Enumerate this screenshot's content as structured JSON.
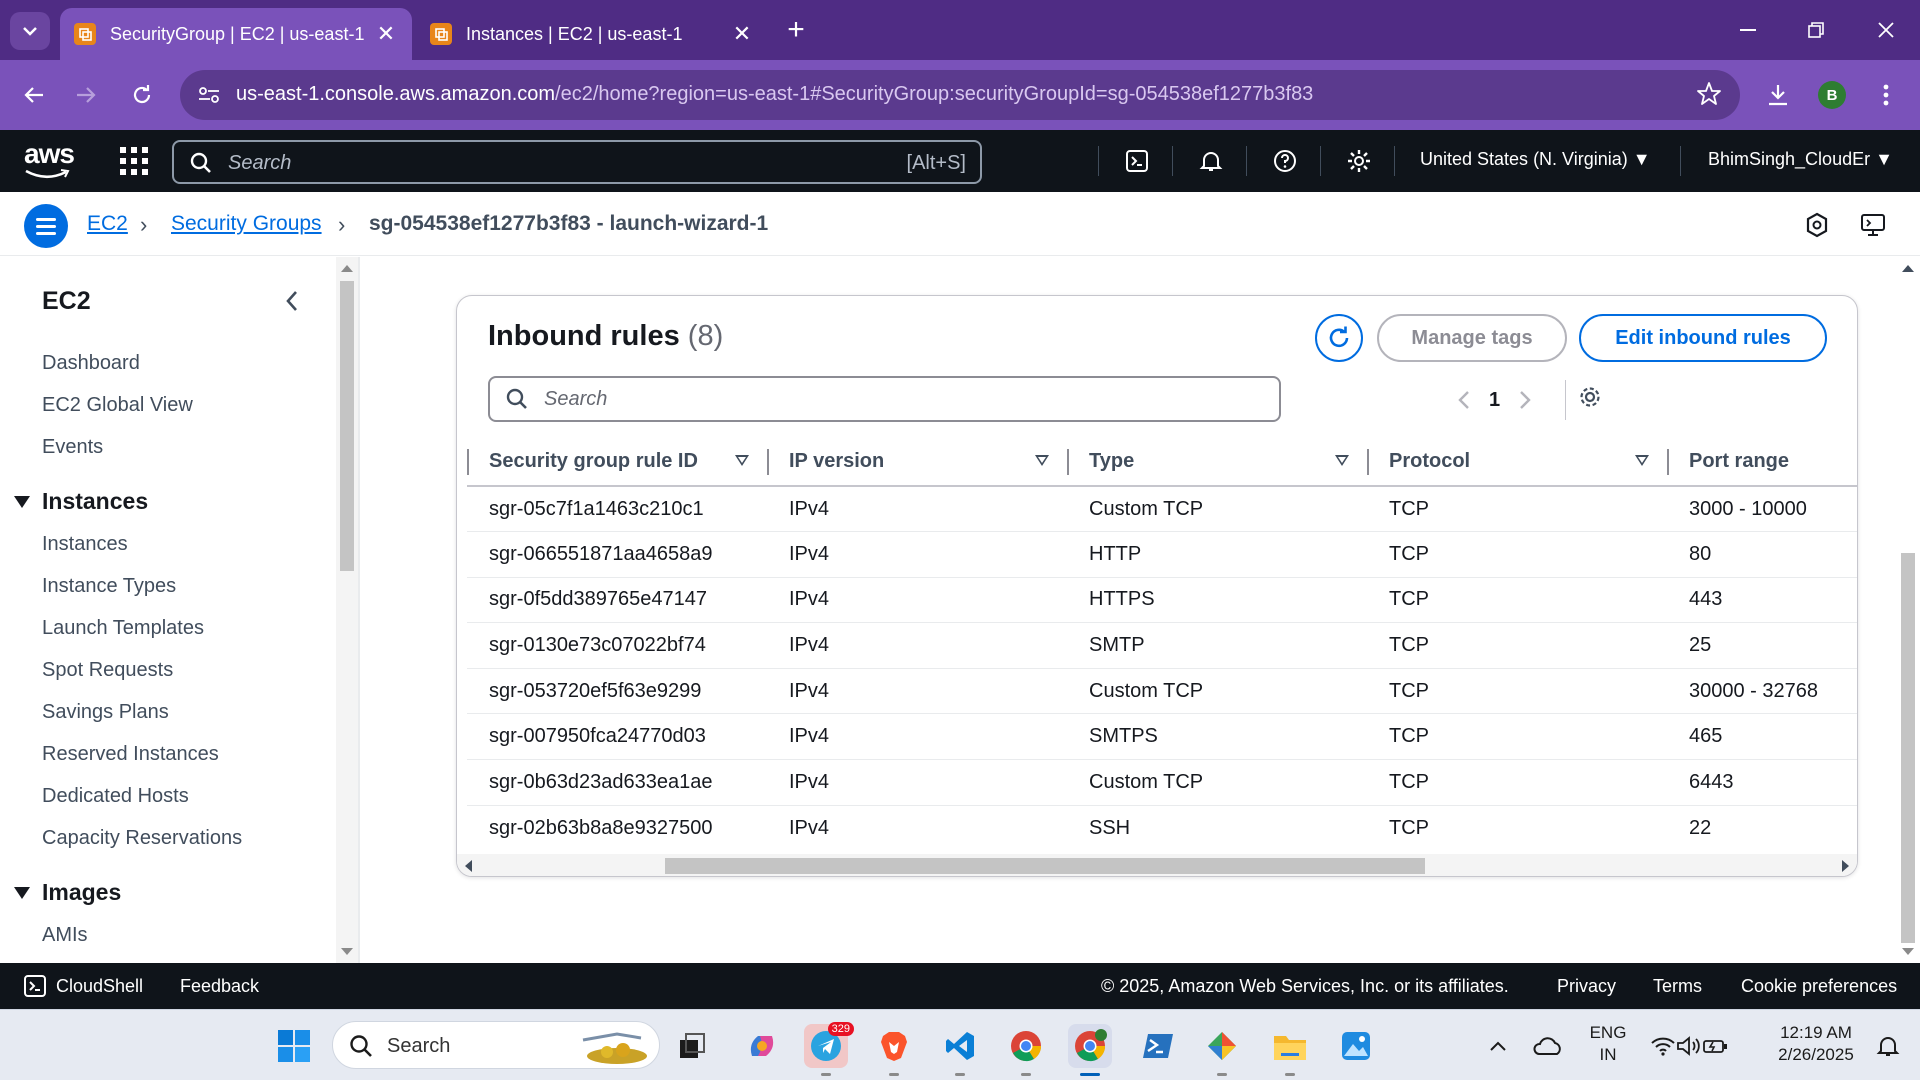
{
  "browser": {
    "tabs": [
      {
        "title": "SecurityGroup | EC2 | us-east-1",
        "active": true
      },
      {
        "title": "Instances | EC2 | us-east-1",
        "active": false
      }
    ],
    "url_host": "us-east-1.console.aws.amazon.com",
    "url_path": "/ec2/home?region=us-east-1#SecurityGroup:securityGroupId=sg-054538ef1277b3f83",
    "profile_initial": "B",
    "accent": "#7a52ba"
  },
  "aws_nav": {
    "logo": "aws",
    "search_placeholder": "Search",
    "search_shortcut": "[Alt+S]",
    "region": "United States (N. Virginia)",
    "account": "BhimSingh_CloudEr"
  },
  "breadcrumb": {
    "items": [
      "EC2",
      "Security Groups"
    ],
    "current": "sg-054538ef1277b3f83 - launch-wizard-1"
  },
  "sidebar": {
    "title": "EC2",
    "top_items": [
      "Dashboard",
      "EC2 Global View",
      "Events"
    ],
    "sections": [
      {
        "label": "Instances",
        "items": [
          "Instances",
          "Instance Types",
          "Launch Templates",
          "Spot Requests",
          "Savings Plans",
          "Reserved Instances",
          "Dedicated Hosts",
          "Capacity Reservations"
        ]
      },
      {
        "label": "Images",
        "items": [
          "AMIs"
        ]
      }
    ]
  },
  "inbound": {
    "title": "Inbound rules",
    "count": "(8)",
    "manage_tags": "Manage tags",
    "edit_rules": "Edit inbound rules",
    "search_placeholder": "Search",
    "page": "1",
    "columns": [
      "Security group rule ID",
      "IP version",
      "Type",
      "Protocol",
      "Port range"
    ],
    "rows": [
      [
        "sgr-05c7f1a1463c210c1",
        "IPv4",
        "Custom TCP",
        "TCP",
        "3000 - 10000"
      ],
      [
        "sgr-066551871aa4658a9",
        "IPv4",
        "HTTP",
        "TCP",
        "80"
      ],
      [
        "sgr-0f5dd389765e47147",
        "IPv4",
        "HTTPS",
        "TCP",
        "443"
      ],
      [
        "sgr-0130e73c07022bf74",
        "IPv4",
        "SMTP",
        "TCP",
        "25"
      ],
      [
        "sgr-053720ef5f63e9299",
        "IPv4",
        "Custom TCP",
        "TCP",
        "30000 - 32768"
      ],
      [
        "sgr-007950fca24770d03",
        "IPv4",
        "SMTPS",
        "TCP",
        "465"
      ],
      [
        "sgr-0b63d23ad633ea1ae",
        "IPv4",
        "Custom TCP",
        "TCP",
        "6443"
      ],
      [
        "sgr-02b63b8a8e9327500",
        "IPv4",
        "SSH",
        "TCP",
        "22"
      ]
    ],
    "link_color": "#006ce0"
  },
  "footer": {
    "cloudshell": "CloudShell",
    "feedback": "Feedback",
    "copyright": "© 2025, Amazon Web Services, Inc. or its affiliates.",
    "privacy": "Privacy",
    "terms": "Terms",
    "cookies": "Cookie preferences"
  },
  "taskbar": {
    "search_placeholder": "Search",
    "telegram_badge": "329",
    "lang_line1": "ENG",
    "lang_line2": "IN",
    "time": "12:19 AM",
    "date": "2/26/2025"
  }
}
